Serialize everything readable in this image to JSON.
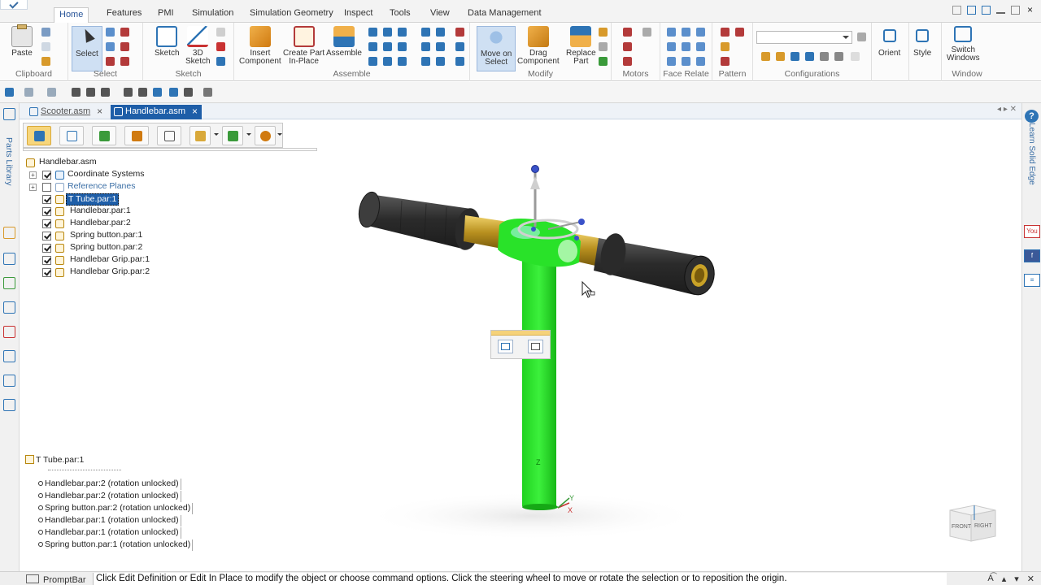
{
  "ribbon": {
    "tabs": [
      "Home",
      "Features",
      "PMI",
      "Simulation",
      "Simulation Geometry",
      "Inspect",
      "Tools",
      "View",
      "Data Management"
    ],
    "active_tab": "Home",
    "groups": {
      "clipboard": {
        "label": "Clipboard",
        "paste": "Paste"
      },
      "select": {
        "label": "Select",
        "select": "Select"
      },
      "sketch": {
        "label": "Sketch",
        "sketch": "Sketch",
        "sketch3d_1": "3D",
        "sketch3d_2": "Sketch"
      },
      "assemble": {
        "label": "Assemble",
        "insert_1": "Insert",
        "insert_2": "Component",
        "create_1": "Create Part",
        "create_2": "In-Place",
        "assemble": "Assemble"
      },
      "modify": {
        "label": "Modify",
        "move_1": "Move on",
        "move_2": "Select",
        "drag_1": "Drag",
        "drag_2": "Component",
        "replace_1": "Replace",
        "replace_2": "Part"
      },
      "motors": {
        "label": "Motors"
      },
      "face_relate": {
        "label": "Face Relate"
      },
      "pattern": {
        "label": "Pattern"
      },
      "configurations": {
        "label": "Configurations"
      },
      "orient": {
        "label": "Orient"
      },
      "style": {
        "label": "Style"
      },
      "window": {
        "label": "Window",
        "switch_1": "Switch",
        "switch_2": "Windows"
      }
    }
  },
  "left_panel": {
    "vertical_label": "Parts Library"
  },
  "right_panel": {
    "vertical_label": "Learn Solid Edge",
    "help_glyph": "?",
    "icons": [
      "You",
      "f",
      "≡"
    ]
  },
  "doc_tabs": [
    {
      "label": "Scooter.asm",
      "active": false,
      "close": "×"
    },
    {
      "label": "Handlebar.asm",
      "active": true,
      "close": "×"
    }
  ],
  "tree": {
    "root": "Handlebar.asm",
    "items": [
      {
        "label": "Coordinate Systems",
        "expander": "+",
        "checked": true
      },
      {
        "label": "Reference Planes",
        "expander": "+",
        "checked": false
      },
      {
        "label": "T Tube.par:1",
        "checked": true,
        "selected": true
      },
      {
        "label": "Handlebar.par:1",
        "checked": true
      },
      {
        "label": "Handlebar.par:2",
        "checked": true
      },
      {
        "label": "Spring button.par:1",
        "checked": true
      },
      {
        "label": "Spring button.par:2",
        "checked": true
      },
      {
        "label": "Handlebar Grip.par:1",
        "checked": true
      },
      {
        "label": "Handlebar Grip.par:2",
        "checked": true
      }
    ]
  },
  "relationships": {
    "header": "T Tube.par:1",
    "items": [
      "Handlebar.par:2  (rotation unlocked)",
      "Handlebar.par:2  (rotation unlocked)",
      "Spring button.par:2  (rotation unlocked)",
      "Handlebar.par:1  (rotation unlocked)",
      "Handlebar.par:1  (rotation unlocked)",
      "Spring button.par:1  (rotation unlocked)"
    ]
  },
  "model": {
    "axis_label_z": "Z",
    "axis_label_y": "Y",
    "axis_label_x": "X"
  },
  "viewcube": {
    "front": "FRONT",
    "right": "RIGHT"
  },
  "status": {
    "prompt_label": "PromptBar",
    "prompt_text": "Click Edit Definition or Edit In Place to modify the object or choose command options. Click the steering wheel to move or rotate the selection or to reposition the origin."
  },
  "colors": {
    "accent": "#1e5ea8",
    "selection_green": "#2ee62e",
    "gold": "#c9a227",
    "grip": "#3a3a3a"
  }
}
